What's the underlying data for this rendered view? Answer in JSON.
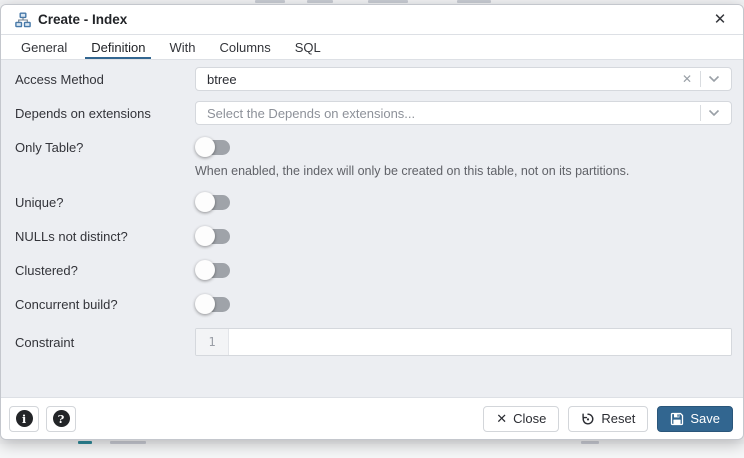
{
  "window": {
    "title": "Create - Index"
  },
  "tabs": [
    {
      "label": "General"
    },
    {
      "label": "Definition"
    },
    {
      "label": "With"
    },
    {
      "label": "Columns"
    },
    {
      "label": "SQL"
    }
  ],
  "active_tab": "Definition",
  "form": {
    "access_method": {
      "label": "Access Method",
      "value": "btree"
    },
    "depends": {
      "label": "Depends on extensions",
      "placeholder": "Select the Depends on extensions..."
    },
    "only_table": {
      "label": "Only Table?",
      "enabled": false,
      "helper": "When enabled, the index will only be created on this table, not on its partitions."
    },
    "unique": {
      "label": "Unique?",
      "enabled": false
    },
    "nulls_not_distinct": {
      "label": "NULLs not distinct?",
      "enabled": false
    },
    "clustered": {
      "label": "Clustered?",
      "enabled": false
    },
    "concurrent_build": {
      "label": "Concurrent build?",
      "enabled": false
    },
    "constraint": {
      "label": "Constraint",
      "line_number": "1",
      "value": ""
    }
  },
  "footer": {
    "close_label": "Close",
    "reset_label": "Reset",
    "save_label": "Save"
  },
  "icons": {
    "close_glyph": "✕",
    "clear_glyph": "✕",
    "info_glyph": "i",
    "help_glyph": "?"
  },
  "colors": {
    "accent": "#326690",
    "toggle_track": "#9fa3a9"
  }
}
